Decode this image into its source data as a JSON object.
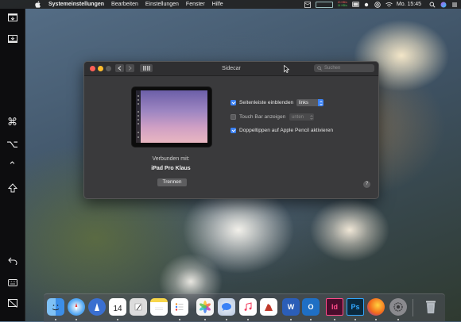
{
  "menubar": {
    "app_name": "Systemeinstellungen",
    "items": [
      "Bearbeiten",
      "Einstellungen",
      "Fenster",
      "Hilfe"
    ],
    "net_up": "13 KB/s",
    "net_down": "14 KB/s",
    "clock": "Mo. 15:45"
  },
  "window": {
    "title": "Sidecar",
    "search_placeholder": "Suchen",
    "connected_label": "Verbunden mit:",
    "device_name": "iPad Pro Klaus",
    "disconnect_label": "Trennen",
    "help_label": "?",
    "options": [
      {
        "label": "Seitenleiste einblenden",
        "checked": true,
        "select": "links",
        "select_enabled": true
      },
      {
        "label": "Touch Bar anzeigen",
        "checked": false,
        "select": "unten",
        "select_enabled": false
      },
      {
        "label": "Doppeltippen auf Apple Pencil aktivieren",
        "checked": true
      }
    ]
  },
  "dock": {
    "apps": [
      {
        "name": "Finder",
        "icon": "finder-icon",
        "color": "#4da3f0"
      },
      {
        "name": "Safari",
        "icon": "safari-icon",
        "color": "#3c8ee8"
      },
      {
        "name": "Launchpad",
        "icon": "launchpad-icon",
        "color": "#2a6fd6"
      },
      {
        "name": "Kalender",
        "icon": "calendar-icon",
        "color": "#ffffff",
        "text": "14"
      },
      {
        "name": "Script Editor",
        "icon": "script-editor-icon",
        "color": "#d8d8d8"
      },
      {
        "name": "Notizen",
        "icon": "notes-icon",
        "color": "#f9e27a"
      },
      {
        "name": "Erinnerungen",
        "icon": "reminders-icon",
        "color": "#ffffff"
      },
      {
        "name": "Fotos",
        "icon": "photos-icon",
        "color": "#f4f4f4"
      },
      {
        "name": "Nachrichten",
        "icon": "messages-icon",
        "color": "#dfe6f2"
      },
      {
        "name": "Musik",
        "icon": "music-icon",
        "color": "#ffffff"
      },
      {
        "name": "Lexikon",
        "icon": "dictionary-icon",
        "color": "#c0392b"
      },
      {
        "name": "Word",
        "icon": "word-icon",
        "color": "#2b5eb8",
        "text": "W"
      },
      {
        "name": "Outlook",
        "icon": "outlook-icon",
        "color": "#1f6fc4",
        "text": "O"
      },
      {
        "name": "InDesign",
        "icon": "indesign-icon",
        "color": "#4a0d2c",
        "text": "Id"
      },
      {
        "name": "Photoshop",
        "icon": "photoshop-icon",
        "color": "#0b2a3e",
        "text": "Ps"
      },
      {
        "name": "Firefox",
        "icon": "firefox-icon",
        "color": "#f26a1b"
      },
      {
        "name": "Systemeinstellungen",
        "icon": "system-preferences-icon",
        "color": "#8a8a8e"
      }
    ],
    "trash": {
      "name": "Papierkorb",
      "icon": "trash-icon"
    }
  }
}
